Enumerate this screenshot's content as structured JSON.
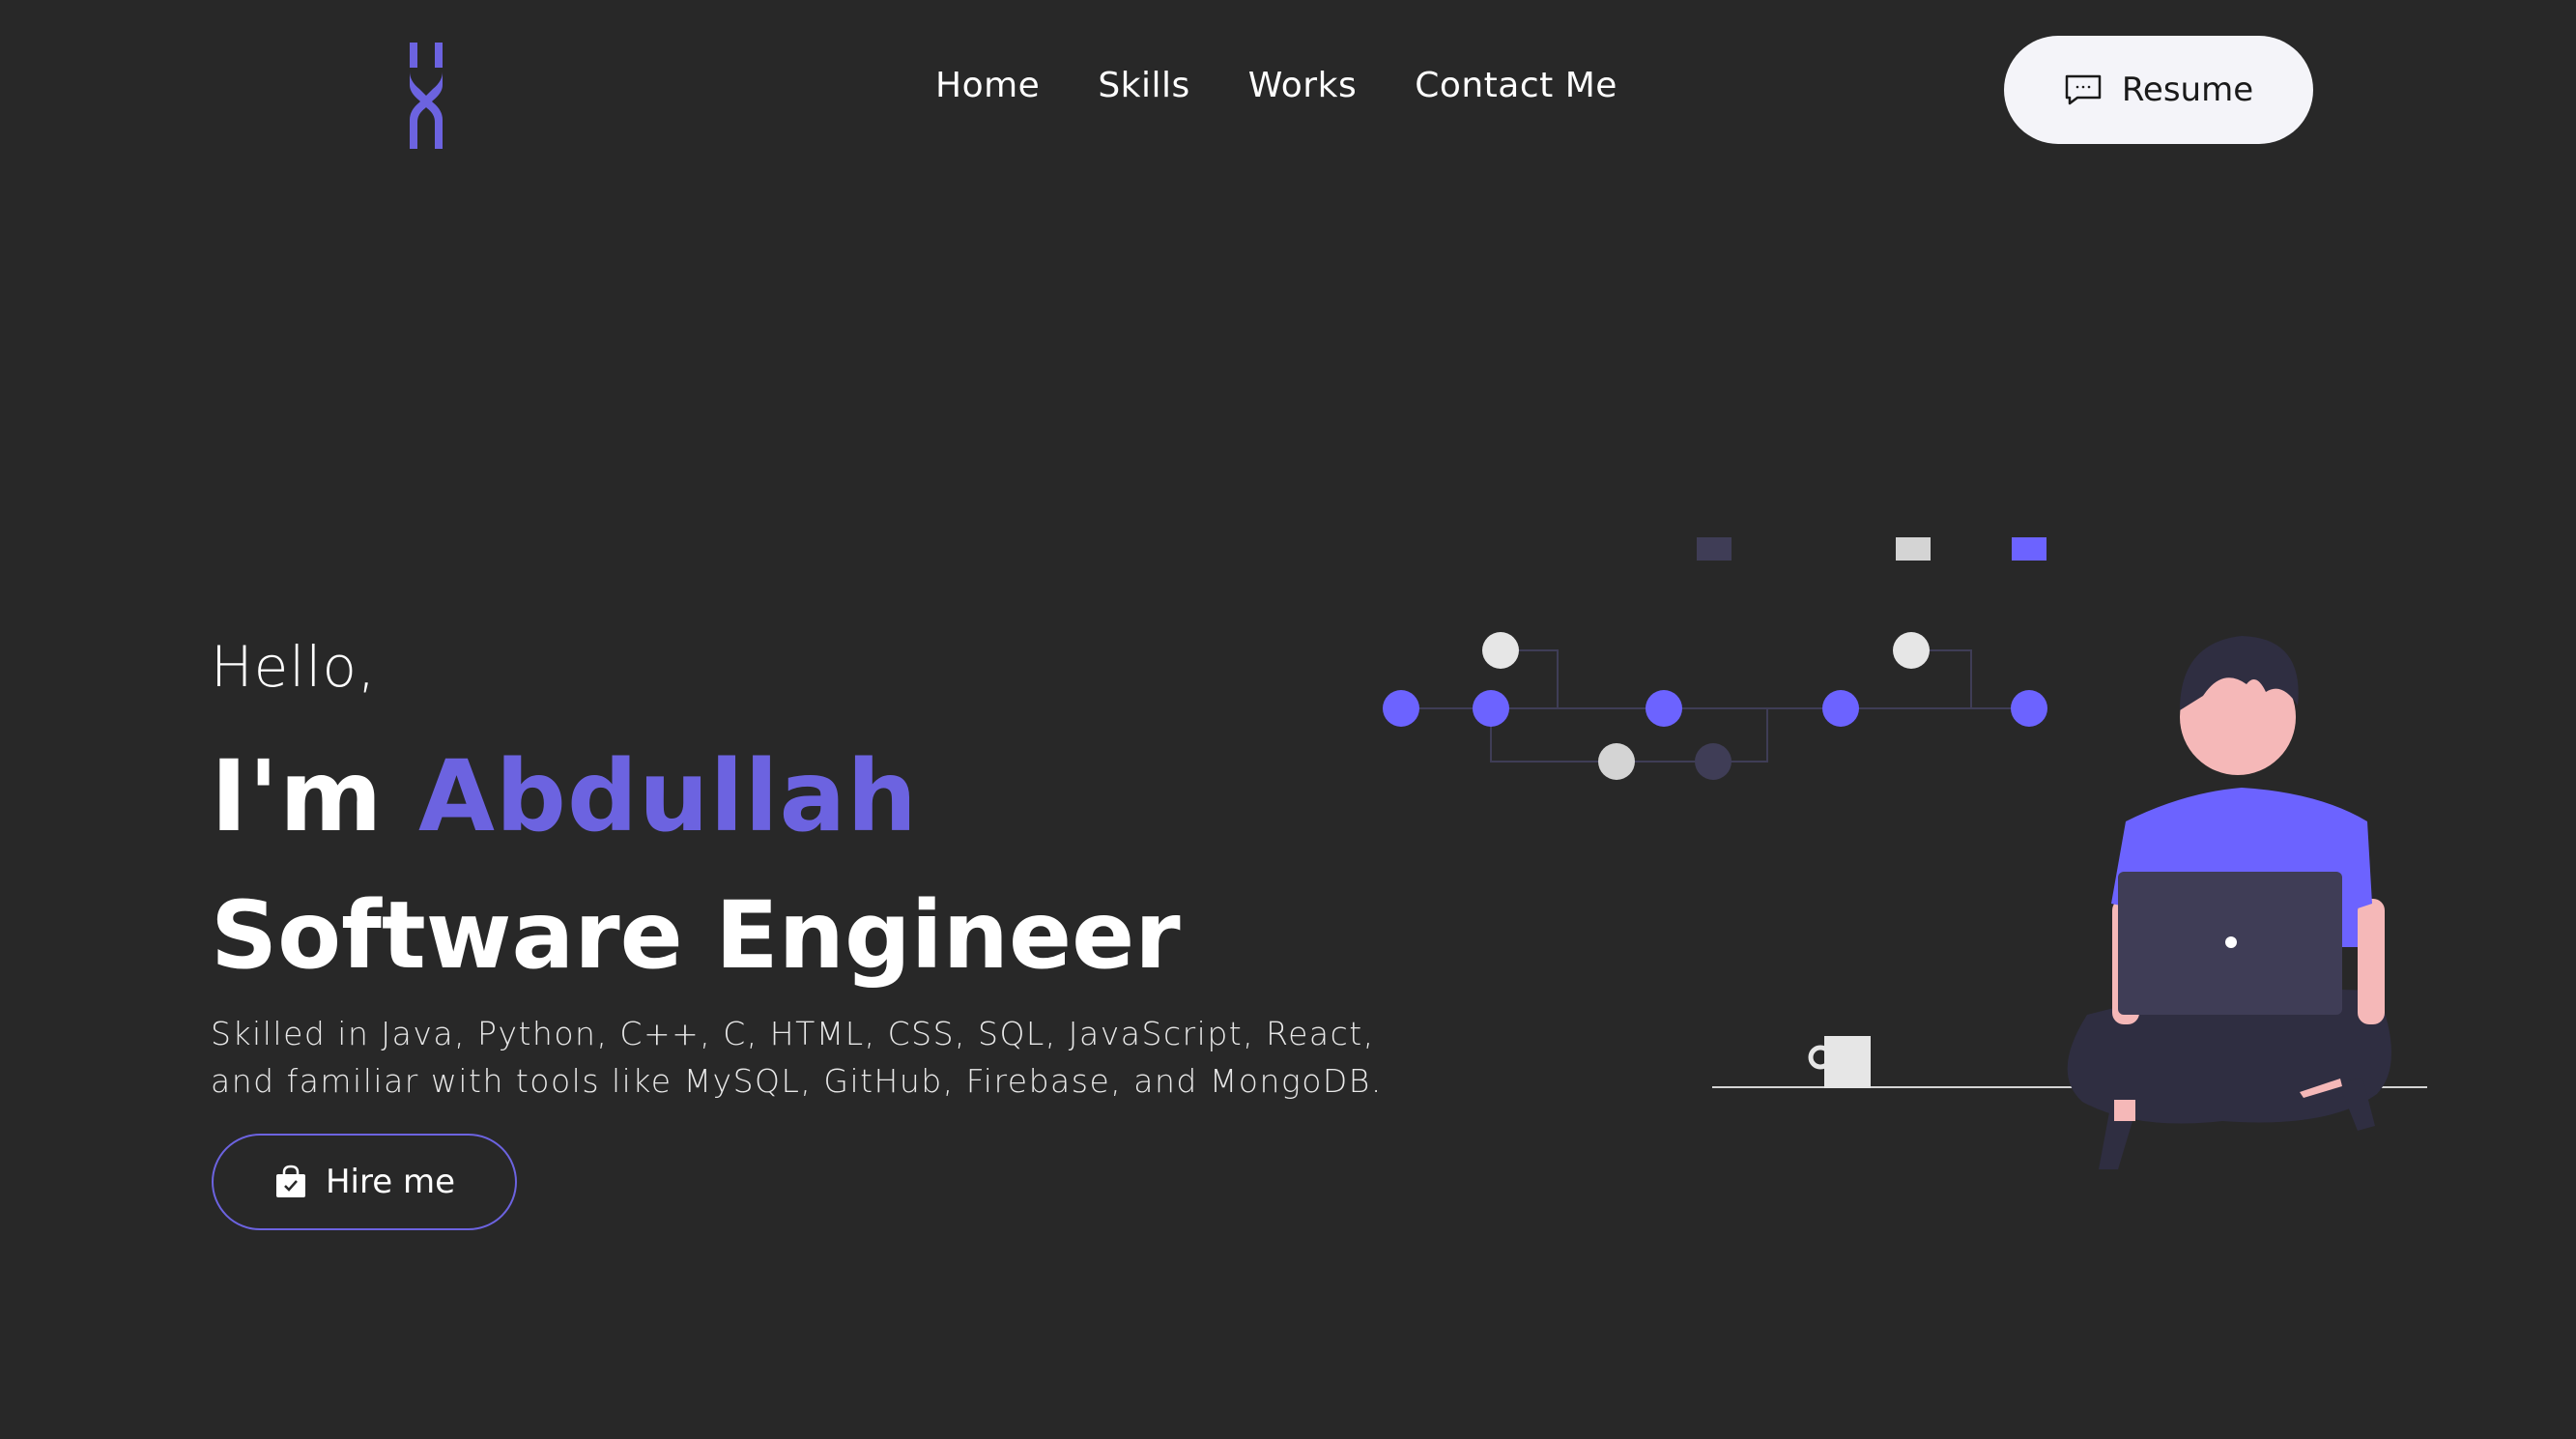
{
  "header": {
    "logo_icon": "x-logo-icon",
    "nav": [
      {
        "label": "Home"
      },
      {
        "label": "Skills"
      },
      {
        "label": "Works"
      },
      {
        "label": "Contact Me"
      }
    ],
    "resume_label": "Resume",
    "resume_icon": "chat-bubble-icon"
  },
  "hero": {
    "greeting": "Hello,",
    "intro_prefix": "I'm",
    "name": "Abdullah",
    "role": "Software Engineer",
    "description_line1": "Skilled in Java, Python, C++, C, HTML, CSS, SQL, JavaScript, React,",
    "description_line2": "and familiar with tools like MySQL, GitHub, Firebase, and MongoDB.",
    "hire_label": "Hire me",
    "hire_icon": "shopping-bag-icon"
  },
  "colors": {
    "background": "#282828",
    "accent": "#6c63ff",
    "text": "#ffffff",
    "button_light": "#f4f4f9"
  }
}
